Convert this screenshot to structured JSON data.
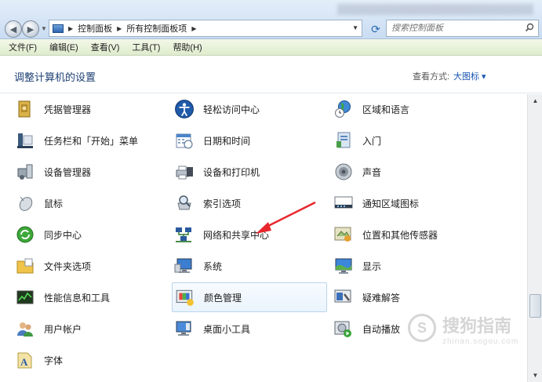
{
  "address": {
    "crumbs": [
      "控制面板",
      "所有控制面板项"
    ],
    "search_placeholder": "搜索控制面板"
  },
  "menu": [
    "文件(F)",
    "编辑(E)",
    "查看(V)",
    "工具(T)",
    "帮助(H)"
  ],
  "header": {
    "title": "调整计算机的设置",
    "view_by_label": "查看方式:",
    "view_by_value": "大图标 ▾"
  },
  "items": [
    {
      "label": "凭据管理器",
      "icon": "credential-manager-icon"
    },
    {
      "label": "轻松访问中心",
      "icon": "ease-of-access-icon"
    },
    {
      "label": "区域和语言",
      "icon": "region-language-icon"
    },
    {
      "label": "任务栏和「开始」菜单",
      "icon": "taskbar-icon"
    },
    {
      "label": "日期和时间",
      "icon": "date-time-icon"
    },
    {
      "label": "入门",
      "icon": "getting-started-icon"
    },
    {
      "label": "设备管理器",
      "icon": "device-manager-icon"
    },
    {
      "label": "设备和打印机",
      "icon": "devices-printers-icon"
    },
    {
      "label": "声音",
      "icon": "sound-icon"
    },
    {
      "label": "鼠标",
      "icon": "mouse-icon"
    },
    {
      "label": "索引选项",
      "icon": "indexing-icon"
    },
    {
      "label": "通知区域图标",
      "icon": "notification-icon"
    },
    {
      "label": "同步中心",
      "icon": "sync-center-icon"
    },
    {
      "label": "网络和共享中心",
      "icon": "network-sharing-icon"
    },
    {
      "label": "位置和其他传感器",
      "icon": "location-sensors-icon"
    },
    {
      "label": "文件夹选项",
      "icon": "folder-options-icon"
    },
    {
      "label": "系统",
      "icon": "system-icon"
    },
    {
      "label": "显示",
      "icon": "display-icon"
    },
    {
      "label": "性能信息和工具",
      "icon": "performance-icon"
    },
    {
      "label": "颜色管理",
      "icon": "color-management-icon"
    },
    {
      "label": "疑难解答",
      "icon": "troubleshooting-icon"
    },
    {
      "label": "用户帐户",
      "icon": "user-accounts-icon"
    },
    {
      "label": "桌面小工具",
      "icon": "gadgets-icon"
    },
    {
      "label": "自动播放",
      "icon": "autoplay-icon"
    },
    {
      "label": "字体",
      "icon": "fonts-icon"
    }
  ],
  "watermark": {
    "text": "搜狗指南",
    "url": "zhinan.sogou.com"
  },
  "colors": {
    "accent": "#1a55b3",
    "title": "#1d3f73",
    "annotation_arrow": "#e8262d"
  }
}
